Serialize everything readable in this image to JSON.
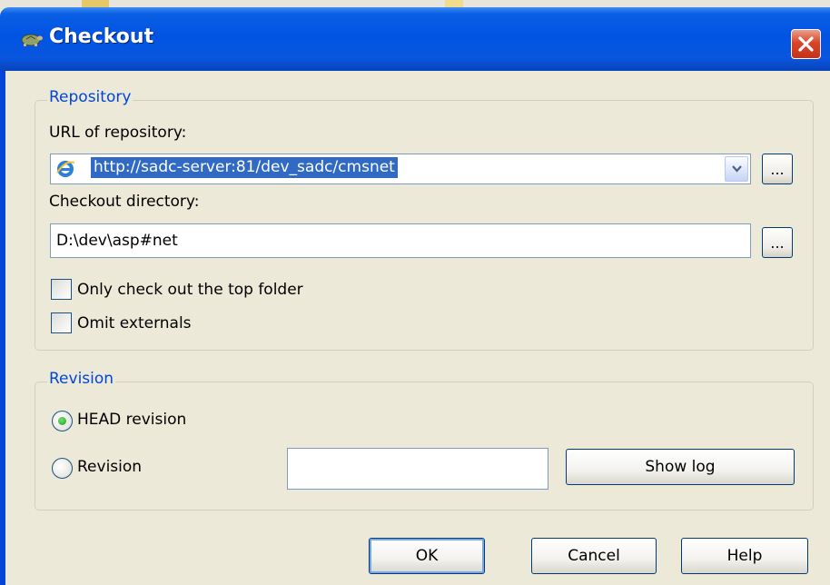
{
  "dialog": {
    "title": "Checkout",
    "title_icon": "tortoisesvn-icon",
    "close_icon": "close-icon"
  },
  "repository": {
    "legend": "Repository",
    "url_label": "URL of repository:",
    "url_value": "http://sadc-server:81/dev_sadc/cmsnet",
    "url_icon": "internet-explorer-icon",
    "browse_label": "...",
    "dir_label": "Checkout directory:",
    "dir_value": "D:\\dev\\asp#net",
    "dir_browse_label": "...",
    "only_top_folder": {
      "label": "Only check out the top folder",
      "checked": false
    },
    "omit_externals": {
      "label": "Omit externals",
      "checked": false
    }
  },
  "revision": {
    "legend": "Revision",
    "head_label": "HEAD revision",
    "head_selected": true,
    "revision_label": "Revision",
    "revision_value": "",
    "show_log_label": "Show log"
  },
  "buttons": {
    "ok": "OK",
    "cancel": "Cancel",
    "help": "Help"
  },
  "colors": {
    "titlebar": "#0054e3",
    "legend_text": "#0046d5",
    "selection": "#316ac5",
    "close_button": "#d9442a",
    "radio_dot": "#21a121"
  }
}
